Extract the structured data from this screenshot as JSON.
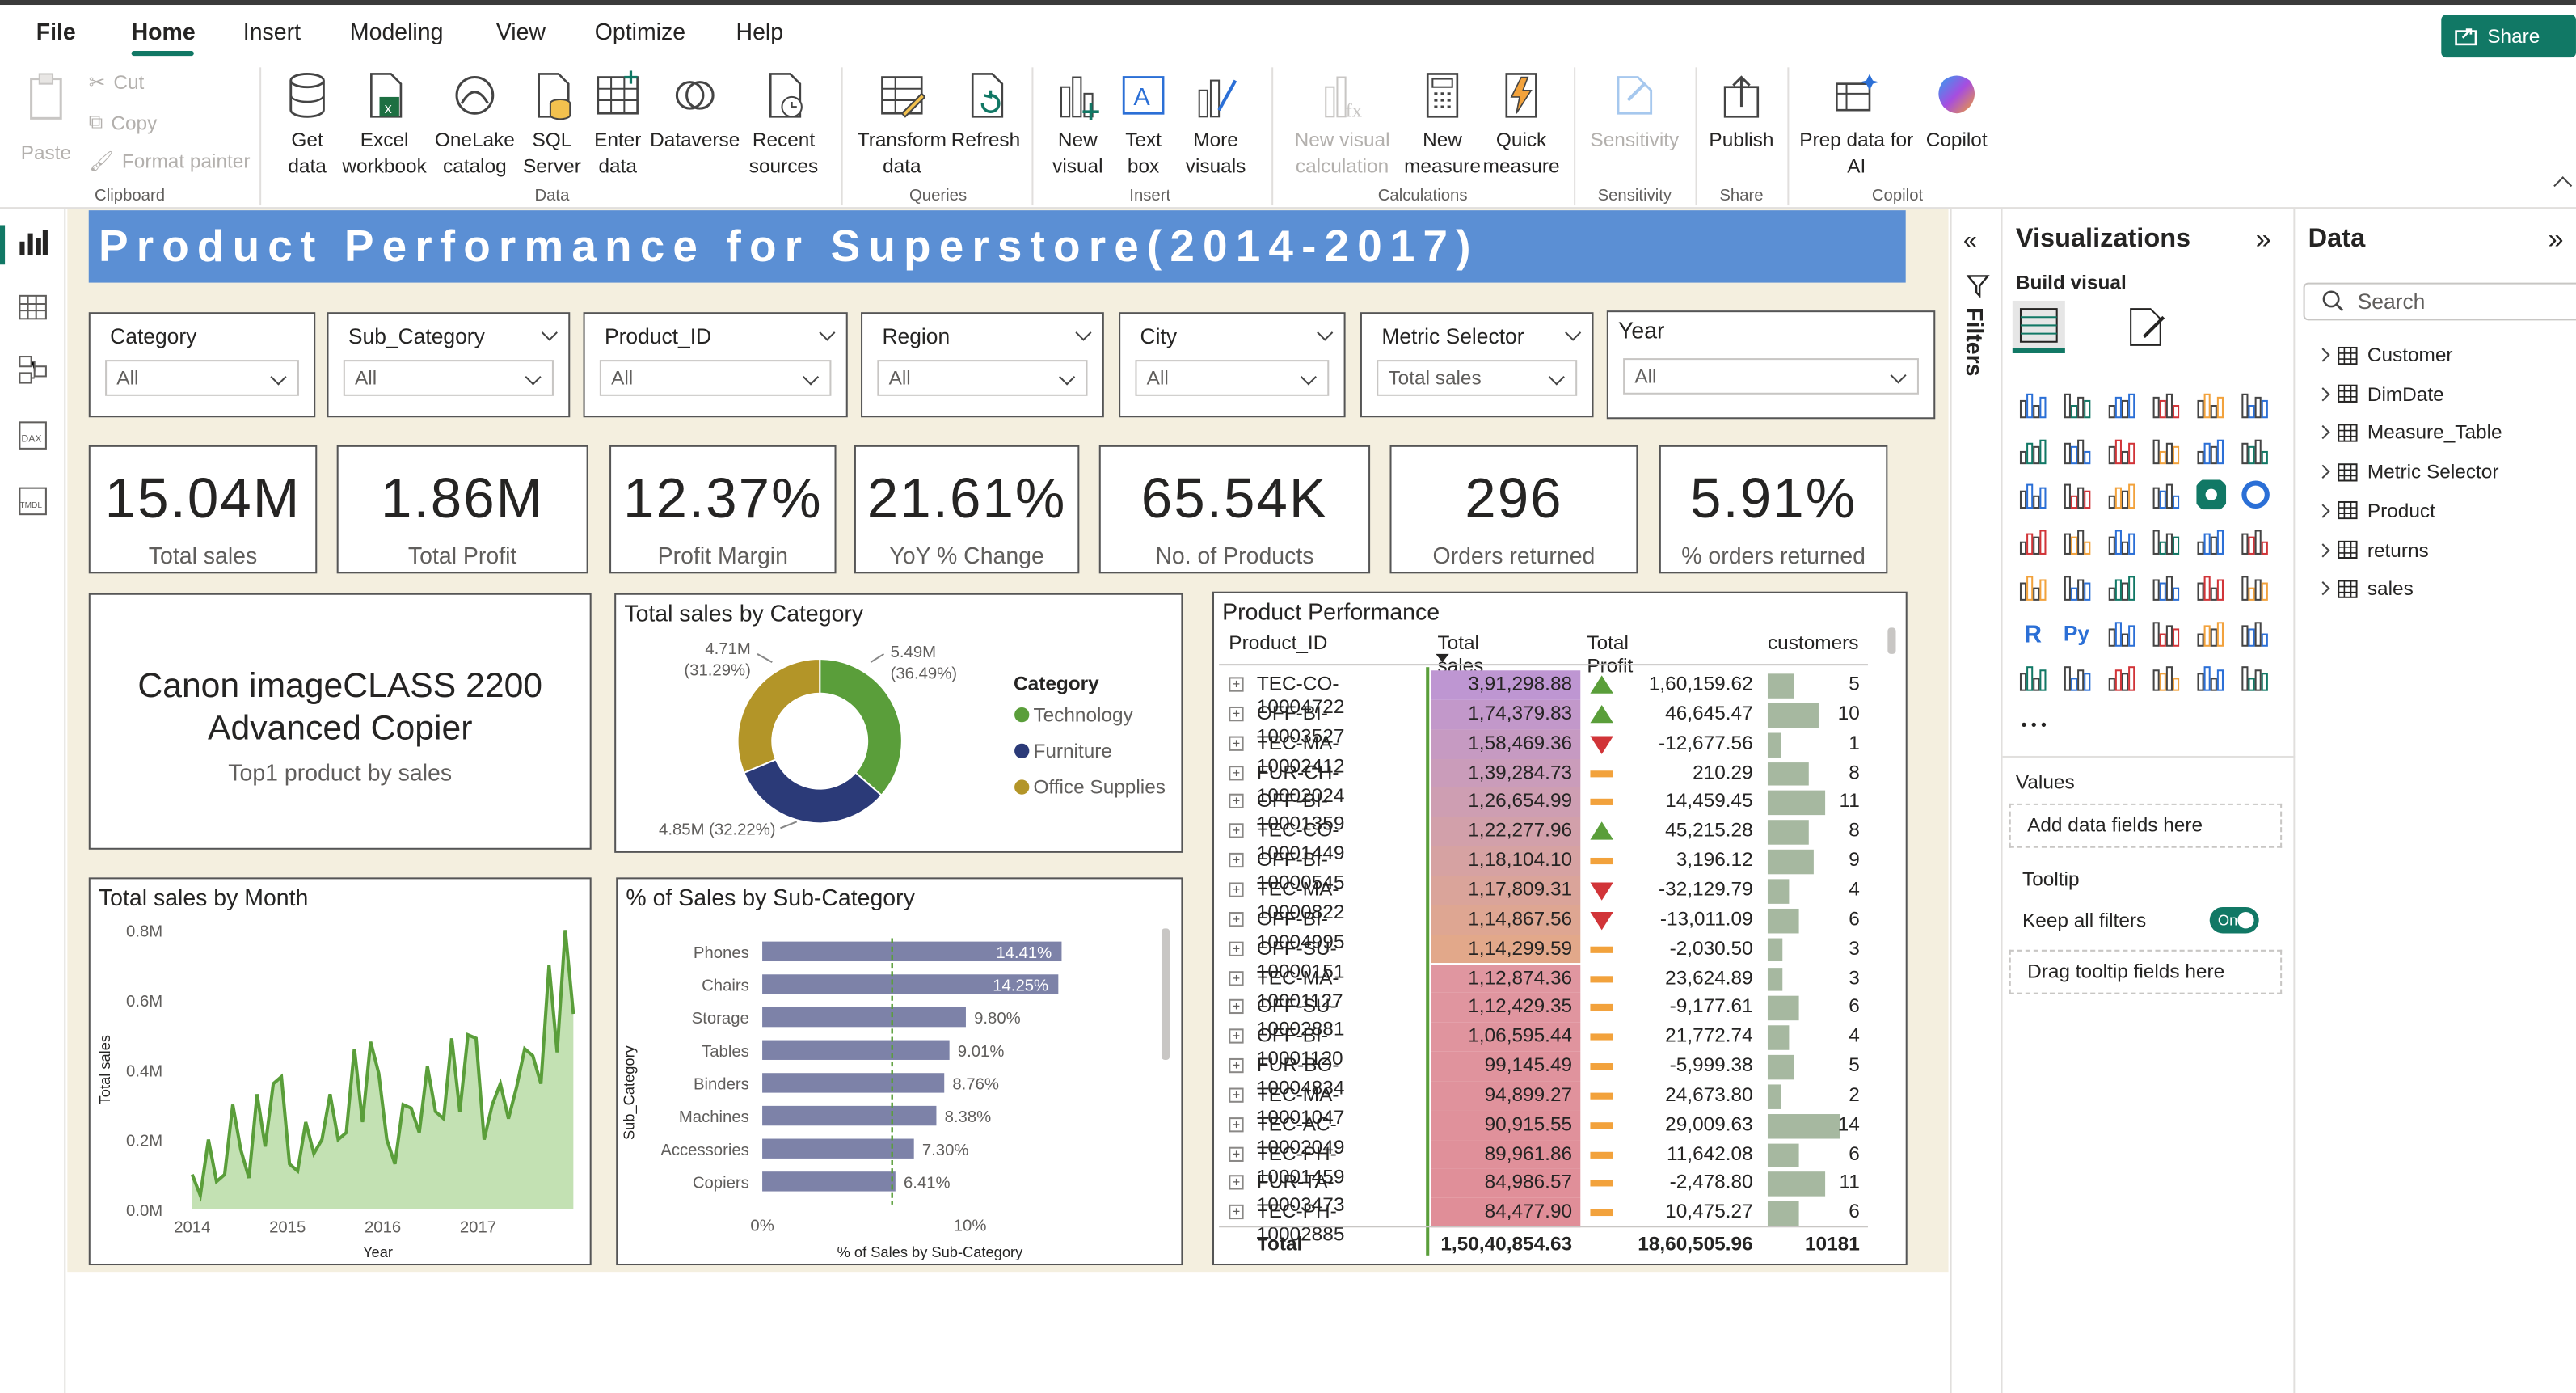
{
  "ribbon": {
    "tabs": [
      "File",
      "Home",
      "Insert",
      "Modeling",
      "View",
      "Optimize",
      "Help"
    ],
    "share_label": "Share",
    "clipboard": {
      "paste": "Paste",
      "cut": "Cut",
      "copy": "Copy",
      "format_painter": "Format painter",
      "group": "Clipboard"
    },
    "data": {
      "get_data": "Get data",
      "excel": "Excel workbook",
      "onelake": "OneLake catalog",
      "sql": "SQL Server",
      "enter": "Enter data",
      "dataverse": "Dataverse",
      "recent": "Recent sources",
      "group": "Data"
    },
    "queries": {
      "transform": "Transform data",
      "refresh": "Refresh",
      "group": "Queries"
    },
    "insert": {
      "new_visual": "New visual",
      "text_box": "Text box",
      "more_visuals": "More visuals",
      "group": "Insert"
    },
    "calculations": {
      "new_visual_calc": "New visual calculation",
      "new_measure": "New measure",
      "quick_measure": "Quick measure",
      "group": "Calculations"
    },
    "sensitivity": {
      "label": "Sensitivity",
      "group": "Sensitivity"
    },
    "share": {
      "publish": "Publish",
      "group": "Share"
    },
    "copilot": {
      "prep": "Prep data for AI",
      "copilot": "Copilot",
      "group": "Copilot"
    }
  },
  "report": {
    "title": "Product Performance for Superstore(2014-2017)",
    "slicers": [
      {
        "label": "Category",
        "value": "All"
      },
      {
        "label": "Sub_Category",
        "value": "All"
      },
      {
        "label": "Product_ID",
        "value": "All"
      },
      {
        "label": "Region",
        "value": "All"
      },
      {
        "label": "City",
        "value": "All"
      },
      {
        "label": "Metric Selector",
        "value": "Total sales"
      },
      {
        "label": "Year",
        "value": "All"
      }
    ],
    "kpis": [
      {
        "value": "15.04M",
        "label": "Total sales"
      },
      {
        "value": "1.86M",
        "label": "Total Profit"
      },
      {
        "value": "12.37%",
        "label": "Profit Margin"
      },
      {
        "value": "21.61%",
        "label": "YoY % Change"
      },
      {
        "value": "65.54K",
        "label": "No. of Products"
      },
      {
        "value": "296",
        "label": "Orders returned"
      },
      {
        "value": "5.91%",
        "label": "% orders returned"
      }
    ],
    "top_product": {
      "name_line1": "Canon imageCLASS 2200",
      "name_line2": "Advanced Copier",
      "caption": "Top1 product by sales"
    },
    "donut_title": "Total sales by Category",
    "line_title": "Total sales by Month",
    "bar_title": "% of Sales by Sub-Category",
    "table": {
      "title": "Product Performance",
      "headers": [
        "Product_ID",
        "Total sales",
        "Total Profit",
        "customers"
      ],
      "rows": [
        {
          "id": "TEC-CO-10004722",
          "sales": "3,91,298.88",
          "profit": "1,60,159.62",
          "cust": "5",
          "trend": "up"
        },
        {
          "id": "OFF-BI-10003527",
          "sales": "1,74,379.83",
          "profit": "46,645.47",
          "cust": "10",
          "trend": "up"
        },
        {
          "id": "TEC-MA-10002412",
          "sales": "1,58,469.36",
          "profit": "-12,677.56",
          "cust": "1",
          "trend": "down"
        },
        {
          "id": "FUR-CH-10002024",
          "sales": "1,39,284.73",
          "profit": "210.29",
          "cust": "8",
          "trend": "flat"
        },
        {
          "id": "OFF-BI-10001359",
          "sales": "1,26,654.99",
          "profit": "14,459.45",
          "cust": "11",
          "trend": "flat"
        },
        {
          "id": "TEC-CO-10001449",
          "sales": "1,22,277.96",
          "profit": "45,215.28",
          "cust": "8",
          "trend": "up"
        },
        {
          "id": "OFF-BI-10000545",
          "sales": "1,18,104.10",
          "profit": "3,196.12",
          "cust": "9",
          "trend": "flat"
        },
        {
          "id": "TEC-MA-10000822",
          "sales": "1,17,809.31",
          "profit": "-32,129.79",
          "cust": "4",
          "trend": "down"
        },
        {
          "id": "OFF-BI-10004995",
          "sales": "1,14,867.56",
          "profit": "-13,011.09",
          "cust": "6",
          "trend": "down"
        },
        {
          "id": "OFF-SU-10000151",
          "sales": "1,14,299.59",
          "profit": "-2,030.50",
          "cust": "3",
          "trend": "flat"
        },
        {
          "id": "TEC-MA-10001127",
          "sales": "1,12,874.36",
          "profit": "23,624.89",
          "cust": "3",
          "trend": "flat"
        },
        {
          "id": "OFF-SU-10002881",
          "sales": "1,12,429.35",
          "profit": "-9,177.61",
          "cust": "6",
          "trend": "flat"
        },
        {
          "id": "OFF-BI-10001120",
          "sales": "1,06,595.44",
          "profit": "21,772.74",
          "cust": "4",
          "trend": "flat"
        },
        {
          "id": "FUR-BO-10004834",
          "sales": "99,145.49",
          "profit": "-5,999.38",
          "cust": "5",
          "trend": "flat"
        },
        {
          "id": "TEC-MA-10001047",
          "sales": "94,899.27",
          "profit": "24,673.80",
          "cust": "2",
          "trend": "flat"
        },
        {
          "id": "TEC-AC-10002049",
          "sales": "90,915.55",
          "profit": "29,009.63",
          "cust": "14",
          "trend": "flat"
        },
        {
          "id": "TEC-PH-10001459",
          "sales": "89,961.86",
          "profit": "11,642.08",
          "cust": "6",
          "trend": "flat"
        },
        {
          "id": "FUR-TA-10003473",
          "sales": "84,986.57",
          "profit": "-2,478.80",
          "cust": "11",
          "trend": "flat"
        },
        {
          "id": "TEC-PH-10002885",
          "sales": "84,477.90",
          "profit": "10,475.27",
          "cust": "6",
          "trend": "flat"
        }
      ],
      "total": {
        "label": "Total",
        "sales": "1,50,40,854.63",
        "profit": "18,60,505.96",
        "cust": "10181"
      },
      "cust_max": 14
    }
  },
  "chart_data": [
    {
      "type": "pie",
      "title": "Total sales by Category",
      "legend_title": "Category",
      "legend_position": "right",
      "categories": [
        "Technology",
        "Furniture",
        "Office Supplies"
      ],
      "values": [
        5.49,
        4.85,
        4.71
      ],
      "labels": [
        "5.49M",
        "4.85M (32.22%)",
        "4.71M"
      ],
      "percent_labels": [
        "(36.49%)",
        "",
        "(31.29%)"
      ],
      "colors": [
        "#5a9e3a",
        "#2b3a78",
        "#b39528"
      ]
    },
    {
      "type": "area",
      "title": "Total sales by Month",
      "xlabel": "Year",
      "ylabel": "Total sales",
      "x_ticks": [
        "2014",
        "2015",
        "2016",
        "2017"
      ],
      "y_ticks": [
        "0.0M",
        "0.2M",
        "0.4M",
        "0.6M",
        "0.8M"
      ],
      "ylim": [
        0,
        0.8
      ],
      "values": [
        0.1,
        0.04,
        0.2,
        0.08,
        0.1,
        0.3,
        0.17,
        0.09,
        0.33,
        0.18,
        0.36,
        0.38,
        0.13,
        0.11,
        0.25,
        0.16,
        0.2,
        0.33,
        0.2,
        0.22,
        0.46,
        0.25,
        0.48,
        0.39,
        0.2,
        0.13,
        0.3,
        0.29,
        0.22,
        0.41,
        0.28,
        0.26,
        0.49,
        0.28,
        0.5,
        0.49,
        0.2,
        0.3,
        0.36,
        0.26,
        0.35,
        0.46,
        0.44,
        0.36,
        0.7,
        0.45,
        0.8,
        0.56
      ],
      "color": "#5a9e3a",
      "fill": "#b9dca6"
    },
    {
      "type": "bar",
      "title": "% of Sales by Sub-Category",
      "xlabel": "% of Sales by Sub-Category",
      "ylabel": "Sub_Category",
      "categories": [
        "Phones",
        "Chairs",
        "Storage",
        "Tables",
        "Binders",
        "Machines",
        "Accessories",
        "Copiers"
      ],
      "values": [
        14.41,
        14.25,
        9.8,
        9.01,
        8.76,
        8.38,
        7.3,
        6.41
      ],
      "labels": [
        "14.41%",
        "14.25%",
        "9.80%",
        "9.01%",
        "8.76%",
        "8.38%",
        "7.30%",
        "6.41%"
      ],
      "x_ticks": [
        "0%",
        "10%"
      ],
      "xlim": [
        0,
        15.5
      ],
      "reference_line": 6.25,
      "color": "#7d82a8"
    }
  ],
  "panes": {
    "filters_label": "Filters",
    "viz_title": "Visualizations",
    "build_visual": "Build visual",
    "values_label": "Values",
    "values_placeholder": "Add data fields here",
    "tooltip_label": "Tooltip",
    "keep_filters": "Keep all filters",
    "toggle_state": "On",
    "tooltip_placeholder": "Drag tooltip fields here",
    "data_title": "Data",
    "search_placeholder": "Search",
    "tables": [
      "Customer",
      "DimDate",
      "Measure_Table",
      "Metric Selector",
      "Product",
      "returns",
      "sales"
    ]
  }
}
